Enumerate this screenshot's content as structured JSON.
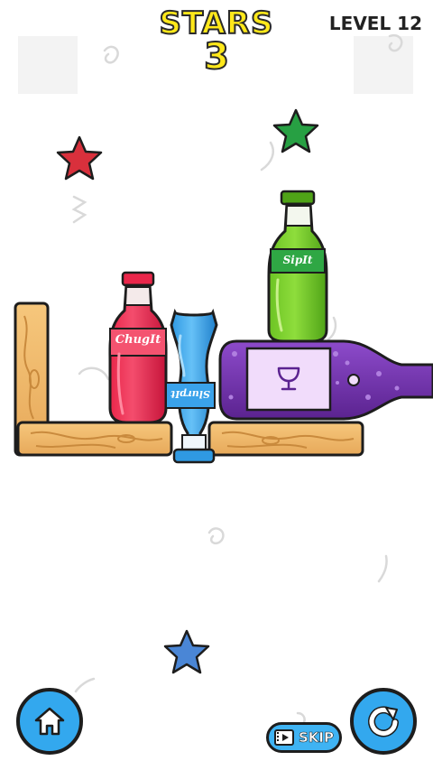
{
  "hud": {
    "stars_label": "STARS",
    "stars_value": "3",
    "level_label": "LEVEL 12"
  },
  "bottles": {
    "red_label": "ChugIt",
    "blue_label": "SlurpIt",
    "green_label": "SipIt"
  },
  "buttons": {
    "home_icon": "home-icon",
    "restart_icon": "restart-icon",
    "skip_label": "SKIP",
    "skip_icon": "video-icon"
  },
  "stars": [
    {
      "color": "#d9303c"
    },
    {
      "color": "#27a043"
    },
    {
      "color": "#4a86d6"
    }
  ],
  "colors": {
    "accent_blue": "#33a8ee",
    "stars_text": "#ffe81a",
    "wood": "#f2be6e"
  }
}
